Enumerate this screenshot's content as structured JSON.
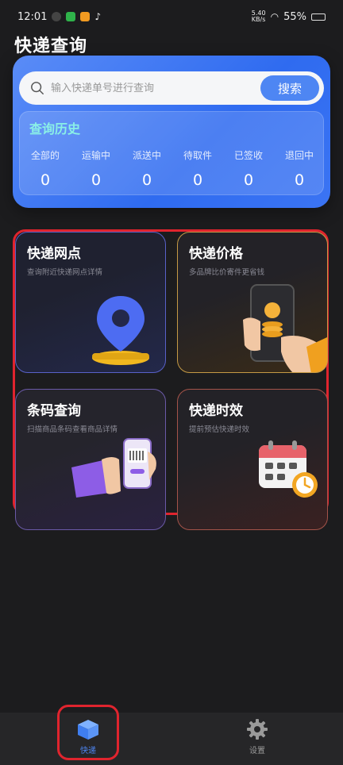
{
  "status_bar": {
    "time": "12:01",
    "network": "5.40\nKB/s",
    "battery": "55%"
  },
  "page": {
    "title": "快递查询"
  },
  "search": {
    "placeholder": "输入快递单号进行查询",
    "button_label": "搜索"
  },
  "history": {
    "title": "查询历史",
    "stats": [
      {
        "label": "全部的",
        "value": "0"
      },
      {
        "label": "运输中",
        "value": "0"
      },
      {
        "label": "派送中",
        "value": "0"
      },
      {
        "label": "待取件",
        "value": "0"
      },
      {
        "label": "已签收",
        "value": "0"
      },
      {
        "label": "退回中",
        "value": "0"
      }
    ]
  },
  "tiles": [
    {
      "title": "快递网点",
      "subtitle": "查询附近快递网点详情"
    },
    {
      "title": "快递价格",
      "subtitle": "多品牌比价寄件更省钱"
    },
    {
      "title": "条码查询",
      "subtitle": "扫描商品条码查看商品详情"
    },
    {
      "title": "快递时效",
      "subtitle": "提前预估快递时效"
    }
  ],
  "bottom_nav": {
    "items": [
      {
        "label": "快递",
        "icon": "box-icon",
        "active": true
      },
      {
        "label": "设置",
        "icon": "gear-icon",
        "active": false
      }
    ]
  },
  "colors": {
    "accent": "#4e86f3",
    "highlight": "#e0242e",
    "card": "#3b74f3"
  }
}
